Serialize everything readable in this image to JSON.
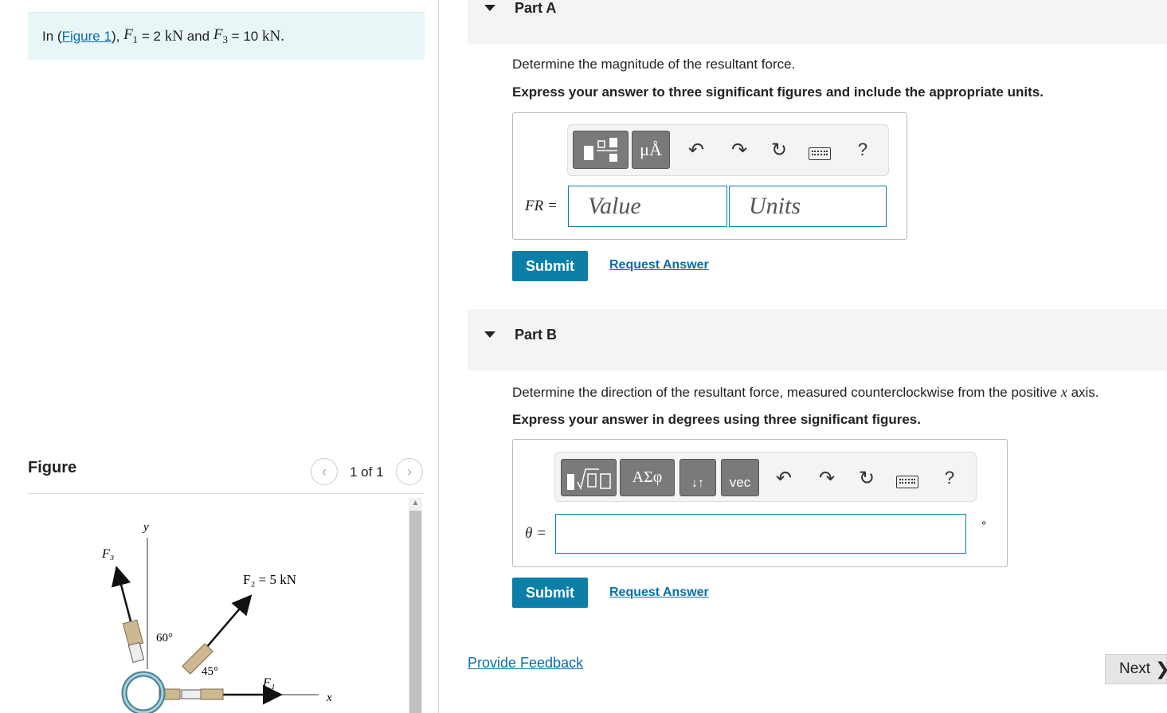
{
  "problem": {
    "prefix": "In (",
    "figure_link": "Figure 1",
    "suffix": "),",
    "f1_symbol": "F",
    "f1_sub": "1",
    "f1_value": "= 2",
    "f1_unit": "kN",
    "and": "and",
    "f3_symbol": "F",
    "f3_sub": "3",
    "f3_value": "= 10",
    "f3_unit": "kN."
  },
  "figure_panel": {
    "title": "Figure",
    "pager_count": "1 of 1",
    "labels": {
      "y_axis": "y",
      "x_axis": "x",
      "f3": "F₃",
      "f2": "F₂ = 5 kN",
      "f1": "F₁",
      "angle_60": "60°",
      "angle_45": "45°"
    }
  },
  "part_a": {
    "title": "Part A",
    "prompt": "Determine the magnitude of the resultant force.",
    "instruction": "Express your answer to three significant figures and include the appropriate units.",
    "tool_units_label": "μÅ",
    "help_label": "?",
    "variable_label": "FR =",
    "value_placeholder": "Value",
    "units_placeholder": "Units",
    "submit_label": "Submit",
    "request_label": "Request Answer"
  },
  "part_b": {
    "title": "Part B",
    "prompt_prefix": "Determine the direction of the resultant force, measured counterclockwise from the positive",
    "prompt_var": "x",
    "prompt_suffix": "axis.",
    "instruction": "Express your answer in degrees using three significant figures.",
    "tool_greek_label": "ΑΣφ",
    "tool_arrows_label": "↓↑",
    "tool_vec_label": "vec",
    "help_label": "?",
    "variable_label": "θ =",
    "unit_symbol": "°",
    "submit_label": "Submit",
    "request_label": "Request Answer"
  },
  "footer": {
    "feedback_label": "Provide Feedback",
    "next_label": "Next"
  },
  "colors": {
    "accent": "#0b7fa8",
    "link": "#0b6ea8",
    "problem_bg": "#e8f6f8"
  }
}
